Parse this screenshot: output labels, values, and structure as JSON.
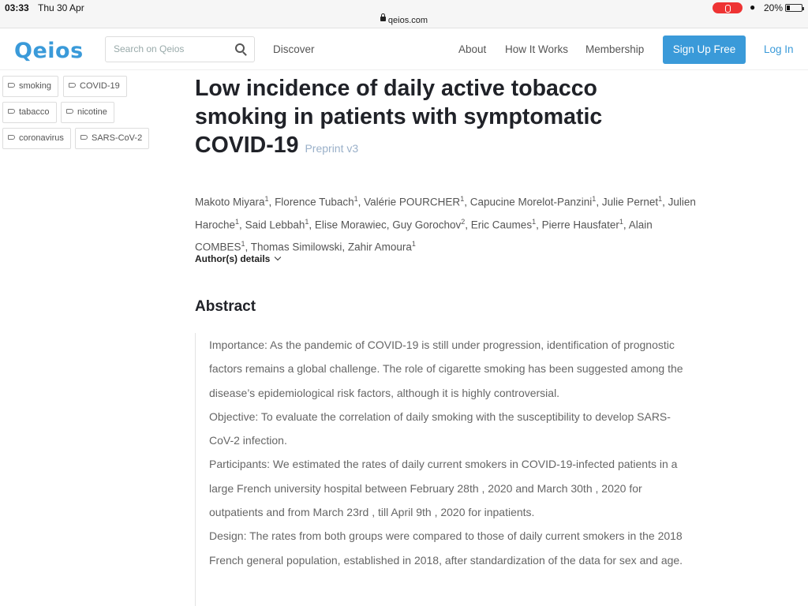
{
  "status_bar": {
    "time": "03:33",
    "date": "Thu 30 Apr",
    "battery": "20%"
  },
  "url_bar": {
    "url": "qeios.com"
  },
  "header": {
    "logo": "Qeios",
    "search_placeholder": "Search on Qeios",
    "nav": {
      "discover": "Discover",
      "about": "About",
      "how_it_works": "How It Works",
      "membership": "Membership"
    },
    "signup": "Sign Up Free",
    "login": "Log In"
  },
  "colors": {
    "accent": "#3a9ad9",
    "record": "#e33333"
  },
  "tags": [
    "smoking",
    "COVID-19",
    "tabacco",
    "nicotine",
    "coronavirus",
    "SARS-CoV-2"
  ],
  "article": {
    "title": "Low incidence of daily active tobacco smoking in patients with symptomatic COVID-19",
    "version": "Preprint v3",
    "authors": [
      {
        "name": "Makoto Miyara",
        "aff": "1"
      },
      {
        "name": "Florence Tubach",
        "aff": "1"
      },
      {
        "name": "Valérie POURCHER",
        "aff": "1"
      },
      {
        "name": "Capucine Morelot-Panzini",
        "aff": "1"
      },
      {
        "name": "Julie Pernet",
        "aff": "1"
      },
      {
        "name": "Julien Haroche",
        "aff": "1"
      },
      {
        "name": "Said Lebbah",
        "aff": "1"
      },
      {
        "name": "Elise Morawiec",
        "aff": ""
      },
      {
        "name": "Guy Gorochov",
        "aff": "2"
      },
      {
        "name": "Eric Caumes",
        "aff": "1"
      },
      {
        "name": "Pierre Hausfater",
        "aff": "1"
      },
      {
        "name": "Alain COMBES",
        "aff": "1"
      },
      {
        "name": "Thomas Similowski",
        "aff": ""
      },
      {
        "name": "Zahir Amoura",
        "aff": "1"
      }
    ],
    "author_details": "Author(s) details",
    "abstract_heading": "Abstract",
    "abstract_paragraphs": [
      "Importance: As the pandemic of COVID-19 is still under progression, identification of prognostic factors remains a global challenge. The role of cigarette smoking has been suggested among the disease’s epidemiological risk factors, although it is highly controversial.",
      "Objective: To evaluate the correlation of daily smoking with the susceptibility to develop SARS-CoV-2 infection.",
      "Participants: We estimated the rates of daily current smokers in COVID-19-infected patients in a large French university hospital between February 28th , 2020 and March 30th , 2020 for outpatients and from March 23rd , till April 9th , 2020 for inpatients.",
      "Design: The rates from both groups were compared to those of daily current smokers in the 2018 French general population, established in 2018, after standardization of the data for sex and age."
    ]
  }
}
